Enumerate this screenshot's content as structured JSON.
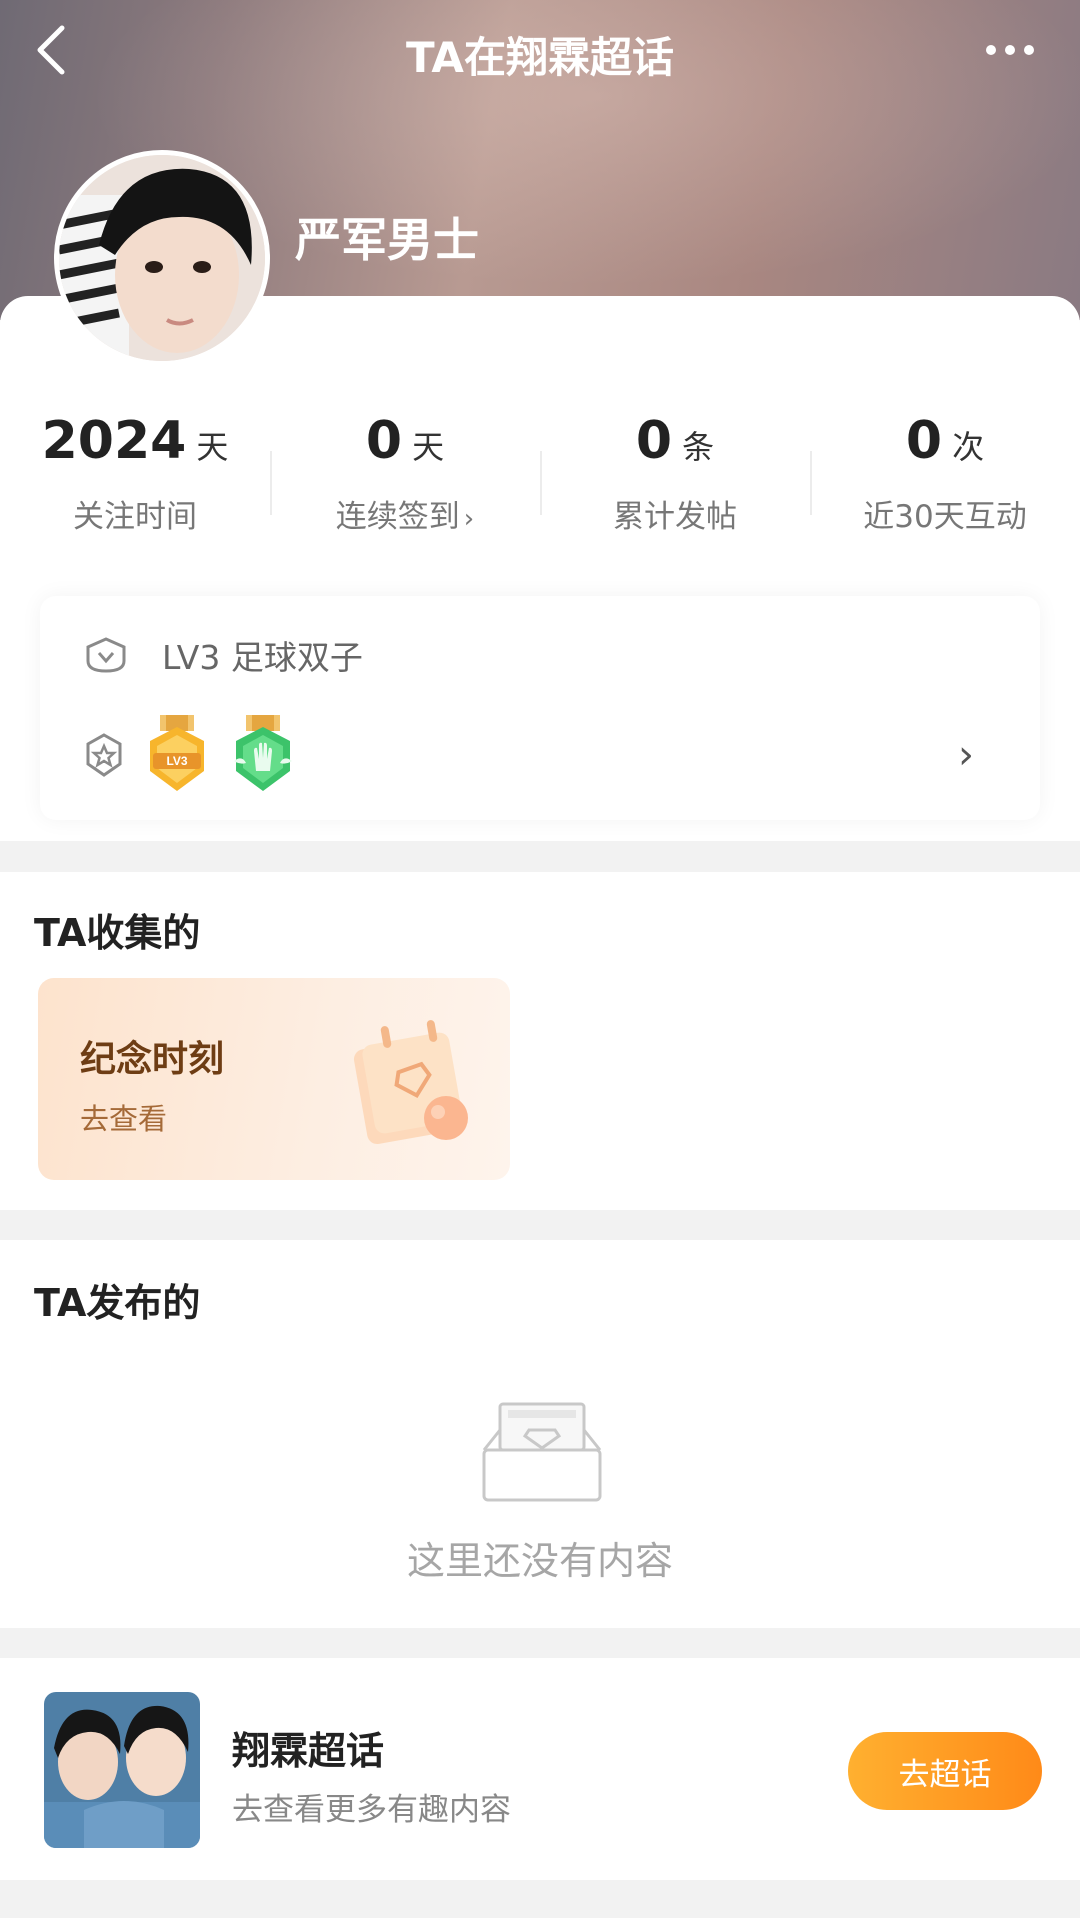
{
  "nav": {
    "title": "TA在翔霖超话",
    "back_icon": "chevron-left-icon",
    "more_icon": "more-dots-icon"
  },
  "profile": {
    "name": "严军男士"
  },
  "stats": [
    {
      "value": "2024",
      "unit": "天",
      "label": "关注时间",
      "chevron": ""
    },
    {
      "value": "0",
      "unit": "天",
      "label": "连续签到",
      "chevron": "›"
    },
    {
      "value": "0",
      "unit": "条",
      "label": "累计发帖",
      "chevron": ""
    },
    {
      "value": "0",
      "unit": "次",
      "label": "近30天互动",
      "chevron": ""
    }
  ],
  "level": {
    "text": "LV3 足球双子"
  },
  "medals": {
    "chevron": "›",
    "lv_badge_text": "LV3"
  },
  "collected": {
    "title": "TA收集的",
    "card": {
      "title": "纪念时刻",
      "subtitle": "去查看"
    }
  },
  "posted": {
    "title": "TA发布的",
    "empty_text": "这里还没有内容"
  },
  "topic": {
    "title": "翔霖超话",
    "subtitle": "去查看更多有趣内容",
    "button": "去超话"
  },
  "colors": {
    "accent": "#ff9a22",
    "medal_gold": "#f7b52c",
    "medal_green": "#3cc36a"
  }
}
